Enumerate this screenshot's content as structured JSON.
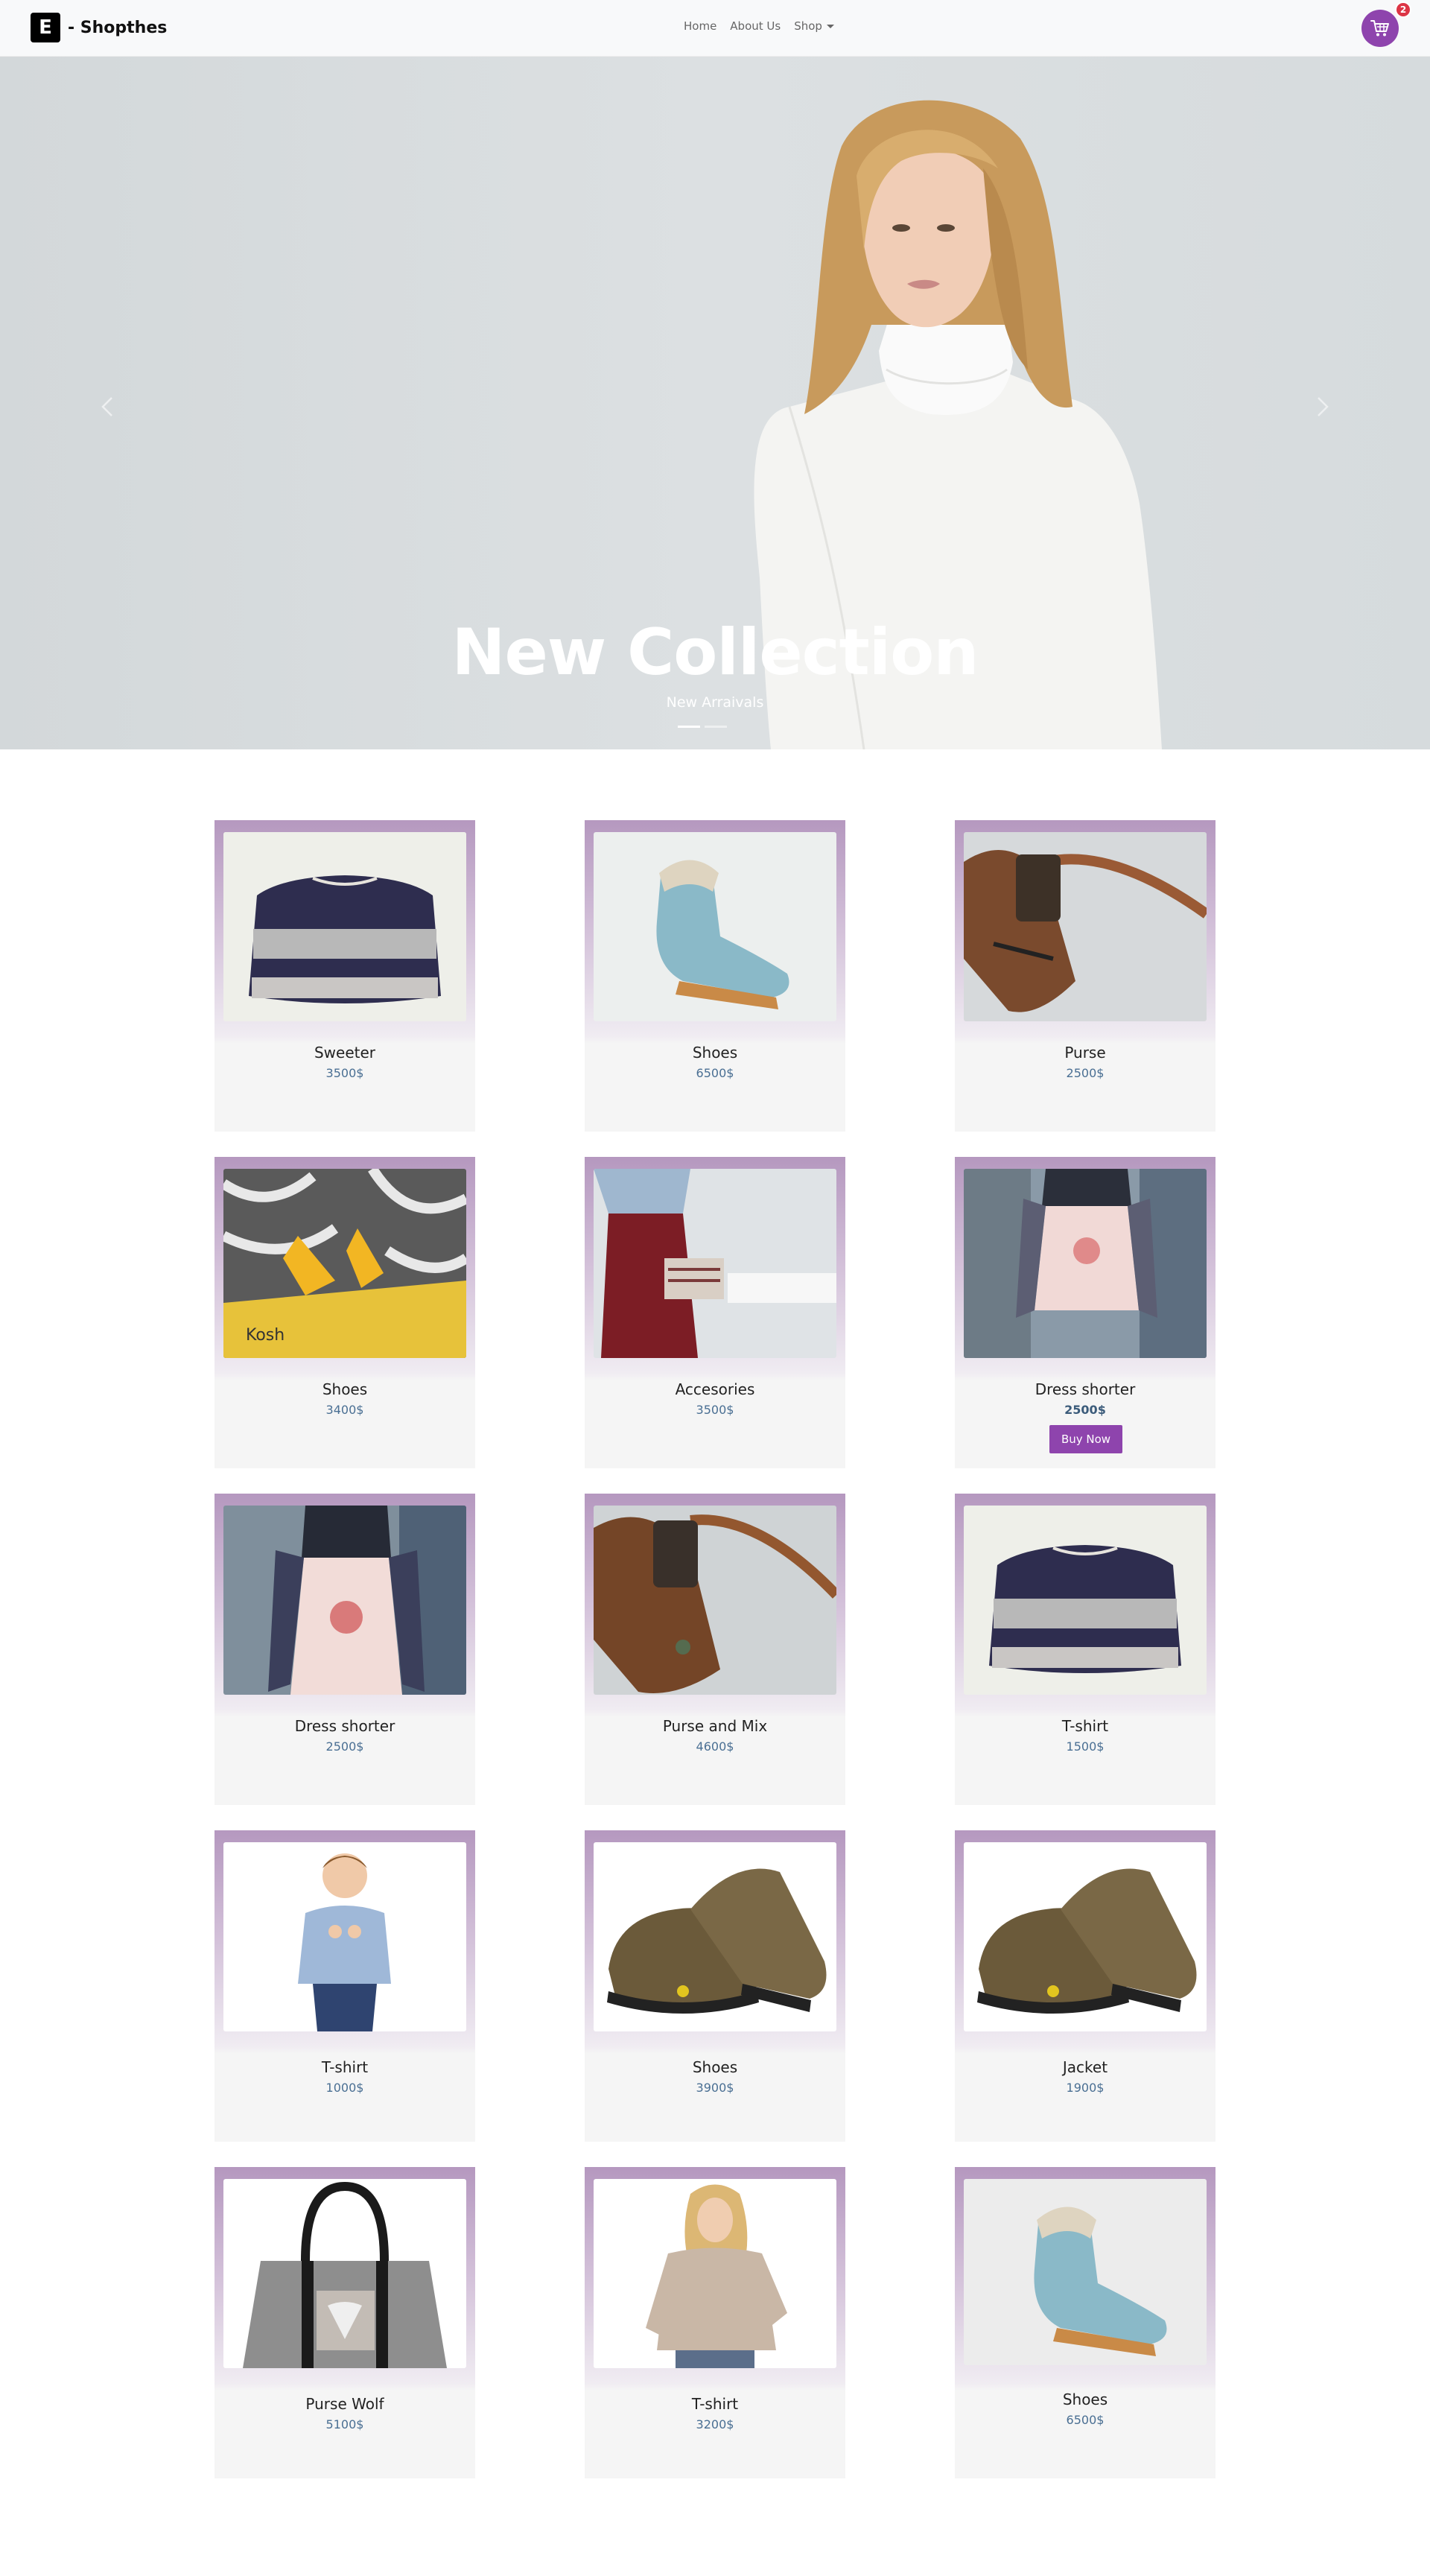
{
  "navbar": {
    "logo_letter": "E",
    "brand": "- Shopthes",
    "links": [
      "Home",
      "About Us",
      "Shop"
    ],
    "cart_count": "2"
  },
  "hero": {
    "title": "New Collection",
    "subtitle": "New Arraivals"
  },
  "products": [
    {
      "name": "Sweeter",
      "price": "3500$",
      "image": "sweater"
    },
    {
      "name": "Shoes",
      "price": "6500$",
      "image": "blue-boot"
    },
    {
      "name": "Purse",
      "price": "2500$",
      "image": "leather-purse"
    },
    {
      "name": "Shoes",
      "price": "3400$",
      "image": "yellow-sneakers"
    },
    {
      "name": "Accesories",
      "price": "3500$",
      "image": "red-skirt-clutch"
    },
    {
      "name": "Dress shorter",
      "price": "2500$",
      "image": "floral-skirt",
      "button": "Buy Now"
    },
    {
      "name": "Dress shorter",
      "price": "2500$",
      "image": "floral-skirt"
    },
    {
      "name": "Purse and Mix",
      "price": "4600$",
      "image": "leather-purse"
    },
    {
      "name": "T-shirt",
      "price": "1500$",
      "image": "sweater"
    },
    {
      "name": "T-shirt",
      "price": "1000$",
      "image": "boy-shirt"
    },
    {
      "name": "Shoes",
      "price": "3900$",
      "image": "hiking-shoes"
    },
    {
      "name": "Jacket",
      "price": "1900$",
      "image": "hiking-shoes"
    },
    {
      "name": "Purse Wolf",
      "price": "5100$",
      "image": "wolf-bag"
    },
    {
      "name": "T-shirt",
      "price": "3200$",
      "image": "woman-sweater"
    },
    {
      "name": "Shoes",
      "price": "6500$",
      "image": "blue-boot"
    }
  ]
}
